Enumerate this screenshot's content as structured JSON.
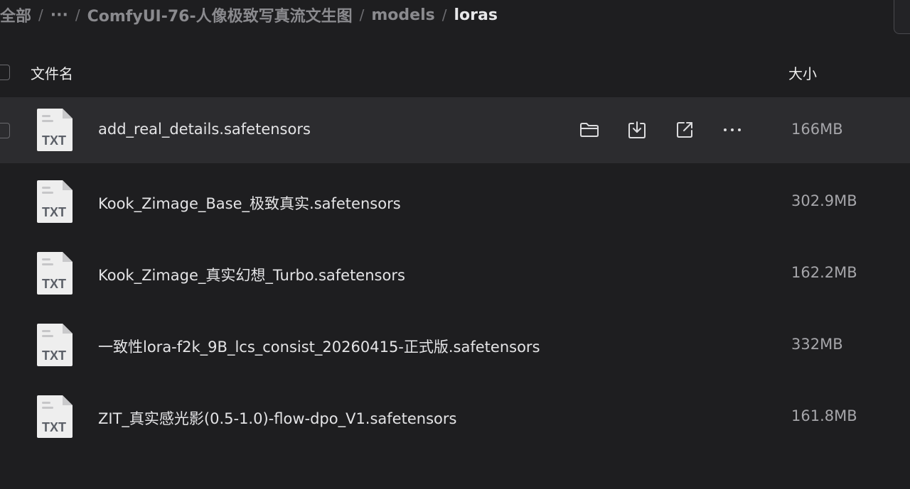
{
  "breadcrumb": {
    "root": "全部",
    "ellipsis": "···",
    "folders": [
      "ComfyUI-76-人像极致写真流文生图",
      "models"
    ],
    "current": "loras"
  },
  "table": {
    "col_name": "文件名",
    "col_size": "大小"
  },
  "files": [
    {
      "name": "add_real_details.safetensors",
      "size": "166MB",
      "icon": "txt-file-icon"
    },
    {
      "name": "Kook_Zimage_Base_极致真实.safetensors",
      "size": "302.9MB",
      "icon": "txt-file-icon"
    },
    {
      "name": "Kook_Zimage_真实幻想_Turbo.safetensors",
      "size": "162.2MB",
      "icon": "txt-file-icon"
    },
    {
      "name": "一致性lora-f2k_9B_lcs_consist_20260415-正式版.safetensors",
      "size": "332MB",
      "icon": "txt-file-icon"
    },
    {
      "name": "ZIT_真实感光影(0.5-1.0)-flow-dpo_V1.safetensors",
      "size": "161.8MB",
      "icon": "txt-file-icon"
    }
  ],
  "file_icon_label": "TXT",
  "row_actions": [
    "folder-icon",
    "download-icon",
    "share-icon",
    "more-icon"
  ],
  "colors": {
    "background": "#1e1e20",
    "hover_row": "#2c2c2f",
    "text_primary": "#e4e4e6",
    "text_secondary": "#a6a6aa"
  }
}
